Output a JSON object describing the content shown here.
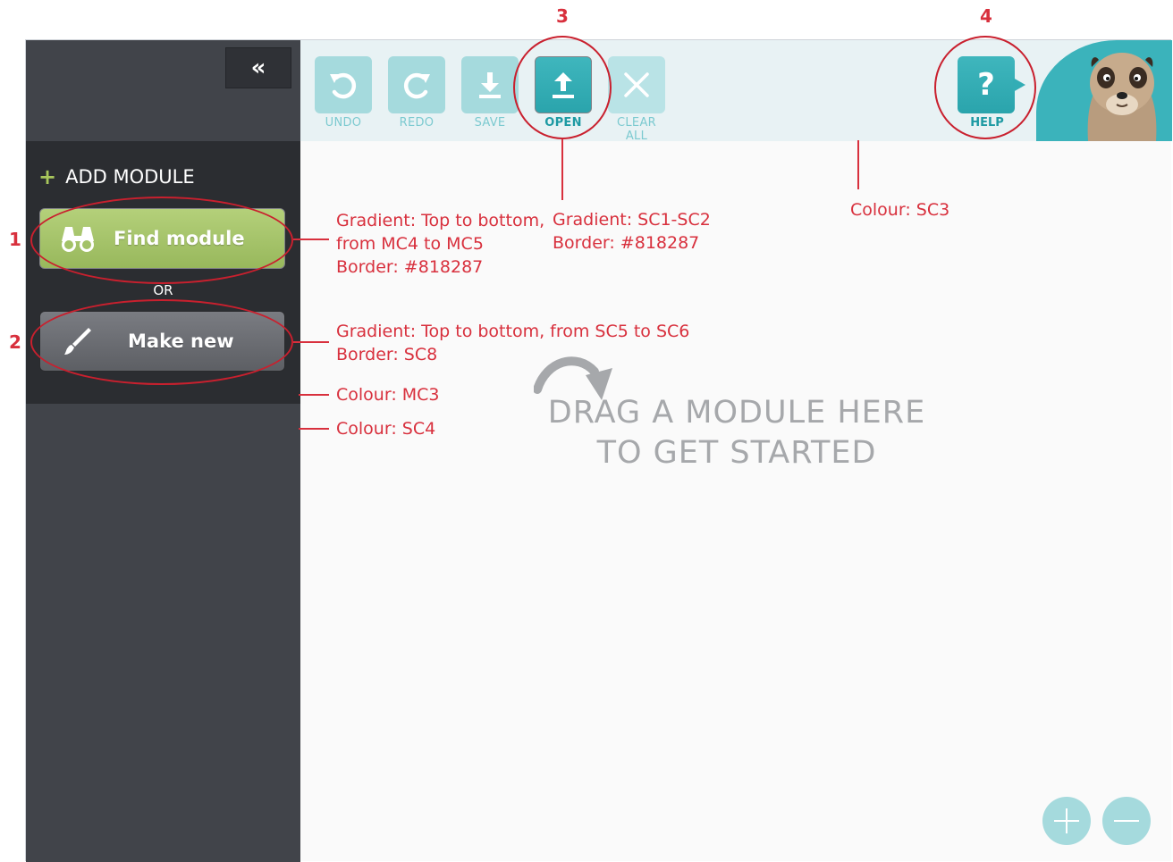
{
  "sidebar": {
    "collapse_label": "«",
    "add_module_title": "ADD MODULE",
    "find_module_label": "Find module",
    "or_label": "OR",
    "make_new_label": "Make new"
  },
  "toolbar": {
    "undo_label": "UNDO",
    "redo_label": "REDO",
    "save_label": "SAVE",
    "open_label": "OPEN",
    "clear_all_label": "CLEAR ALL",
    "help_label": "HELP",
    "help_glyph": "?"
  },
  "canvas": {
    "drag_line1": "DRAG A MODULE HERE",
    "drag_line2": "TO GET STARTED"
  },
  "annotations": {
    "n1": "1",
    "n2": "2",
    "n3": "3",
    "n4": "4",
    "find_module_spec": [
      "Gradient: Top to bottom,",
      "from MC4 to MC5",
      "Border: #818287"
    ],
    "open_spec": [
      "Gradient: SC1-SC2",
      "Border: #818287"
    ],
    "toolbar_spec": "Colour: SC3",
    "make_new_spec": [
      "Gradient: Top to bottom, from SC5 to SC6",
      "Border: SC8"
    ],
    "panel_spec": "Colour: MC3",
    "sidebar_spec": "Colour: SC4"
  },
  "colors": {
    "accent": "#2aa4ac",
    "annotation": "#d8303d",
    "find_gradient_top": "#b4d07a",
    "find_gradient_bottom": "#98b85c",
    "sidebar": "#41444a",
    "panel": "#2b2d31"
  }
}
